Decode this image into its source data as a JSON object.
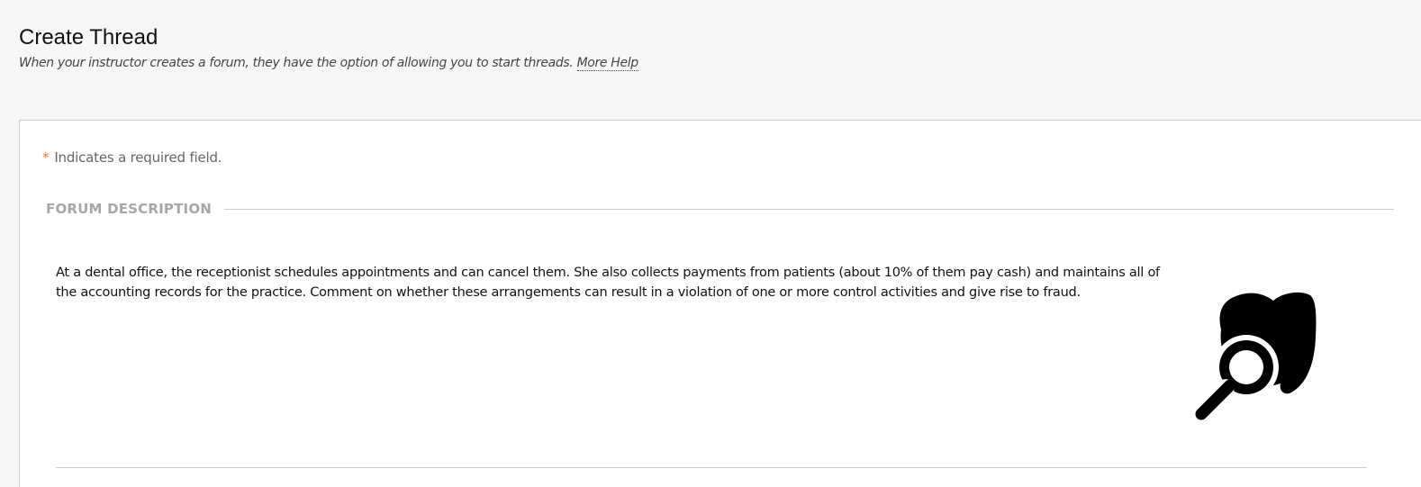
{
  "header": {
    "title": "Create Thread",
    "subtitle": "When your instructor creates a forum, they have the option of allowing you to start threads.",
    "help_link": "More Help"
  },
  "form": {
    "required_star": "*",
    "required_note": "Indicates a required field.",
    "section_title": "FORUM DESCRIPTION",
    "description": "At a dental office, the receptionist schedules appointments and can cancel them. She also collects payments from patients (about 10% of them pay cash) and maintains all of the accounting records for the practice. Comment on whether these arrangements can result in a violation of one or more control activities and give rise to fraud.",
    "image_icon": "tooth-magnifier-icon"
  }
}
